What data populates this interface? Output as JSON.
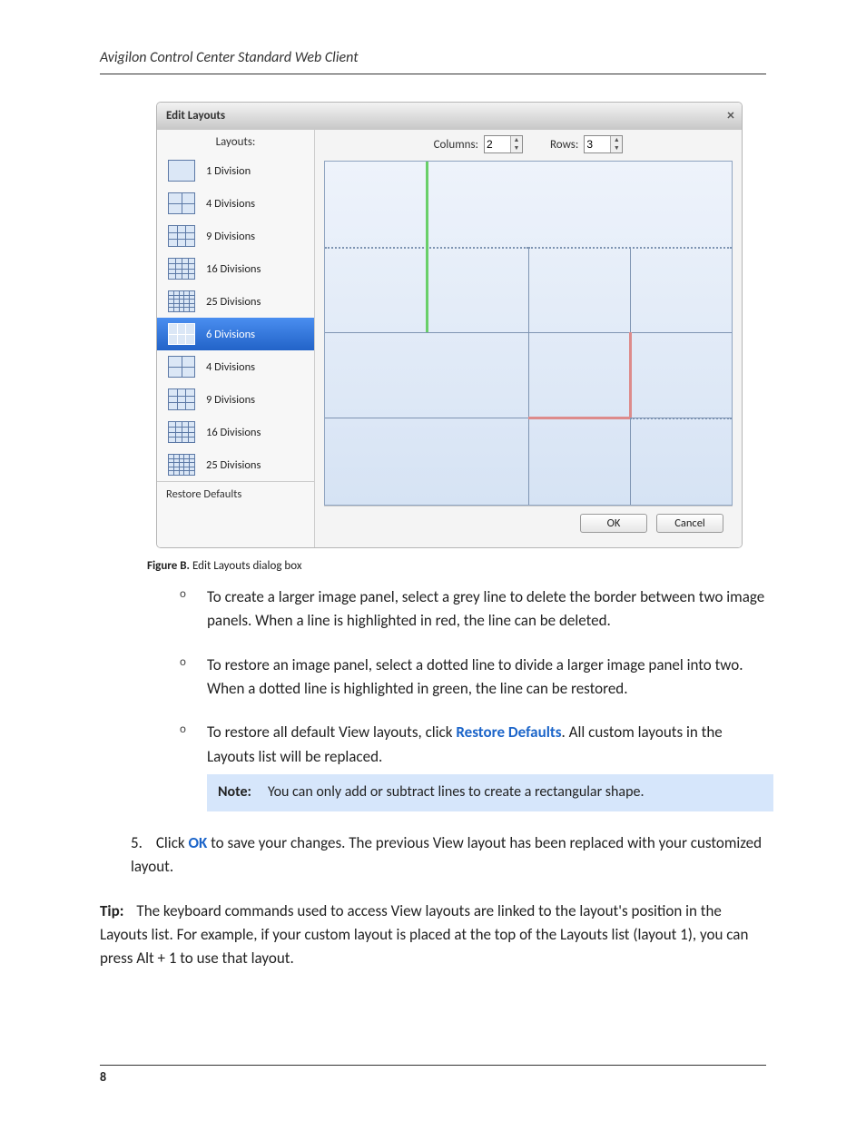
{
  "header": {
    "running_head": "Avigilon Control Center Standard Web Client"
  },
  "dialog": {
    "title": "Edit Layouts",
    "close_glyph": "×",
    "layouts_label": "Layouts:",
    "columns_label": "Columns:",
    "columns_value": "2",
    "rows_label": "Rows:",
    "rows_value": "3",
    "restore_label": "Restore Defaults",
    "ok_label": "OK",
    "cancel_label": "Cancel",
    "layout_items": [
      {
        "label": "1 Division",
        "rows": 1,
        "cols": 1,
        "selected": false
      },
      {
        "label": "4 Divisions",
        "rows": 2,
        "cols": 2,
        "selected": false
      },
      {
        "label": "9 Divisions",
        "rows": 3,
        "cols": 3,
        "selected": false
      },
      {
        "label": "16 Divisions",
        "rows": 4,
        "cols": 4,
        "selected": false
      },
      {
        "label": "25 Divisions",
        "rows": 5,
        "cols": 5,
        "selected": false
      },
      {
        "label": "6 Divisions",
        "rows": 2,
        "cols": 3,
        "selected": true
      },
      {
        "label": "4 Divisions",
        "rows": 2,
        "cols": 2,
        "selected": false
      },
      {
        "label": "9 Divisions",
        "rows": 3,
        "cols": 3,
        "selected": false
      },
      {
        "label": "16 Divisions",
        "rows": 4,
        "cols": 4,
        "selected": false
      },
      {
        "label": "25 Divisions",
        "rows": 5,
        "cols": 5,
        "selected": false
      }
    ]
  },
  "caption": {
    "label": "Figure B.",
    "text": " Edit Layouts dialog box"
  },
  "bullets": [
    "To create a larger image panel, select a grey line to delete the border between two image panels. When a line is highlighted in red, the line can be deleted.",
    "To restore an image panel, select a dotted line to divide a larger image panel into two. When a dotted line is highlighted in green, the line can be restored."
  ],
  "bullet3_pre": "To restore all default View layouts, click ",
  "bullet3_link": "Restore Defaults",
  "bullet3_post": ". All custom layouts in the Layouts list will be replaced.",
  "note": {
    "label": "Note:",
    "text": "You can only add or subtract lines to create a rectangular shape."
  },
  "step5": {
    "num": "5.",
    "pre": "Click ",
    "link": "OK",
    "post": " to save your changes. The previous View layout has been replaced with your customized layout."
  },
  "tip": {
    "label": "Tip:",
    "text": "The keyboard commands used to access View layouts are linked to the layout's position in the Layouts list. For example, if your custom layout is placed at the top of the Layouts list (layout 1), you can press Alt + 1 to use that layout."
  },
  "footer": {
    "page": "8"
  }
}
